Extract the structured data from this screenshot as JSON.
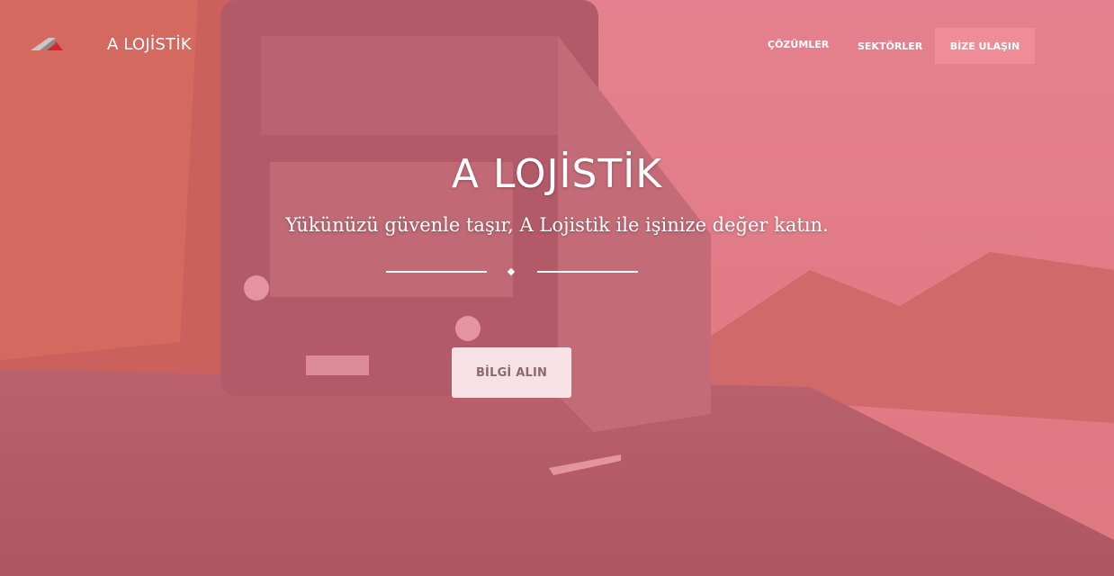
{
  "nav": {
    "brand": "A LOJİSTİK",
    "links": [
      {
        "label": "ÇÖZÜMLER"
      },
      {
        "label": "SEKTÖRLER"
      }
    ],
    "cta_label": "BİZE ULAŞIN"
  },
  "hero": {
    "title": "A LOJİSTİK",
    "subtitle": "Yükünüzü güvenle taşır, A Lojistik ile işinize değer katın.",
    "button_label": "BİLGİ ALIN",
    "background_icon": "truck-on-road-photo"
  },
  "colors": {
    "overlay": "#e26778",
    "cta_bg": "#f596a0",
    "text": "#ffffff",
    "button_bg": "#fff0f2",
    "button_text": "#8a6a6e"
  }
}
